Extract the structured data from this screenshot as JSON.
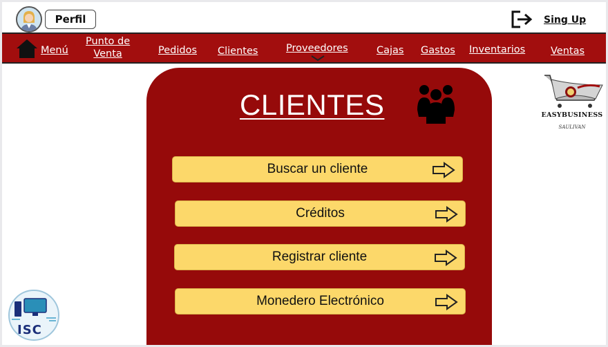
{
  "header": {
    "profile_label": "Perfil",
    "signup_label": "Sing Up"
  },
  "nav": {
    "items": [
      {
        "label": "Menú"
      },
      {
        "label": "Punto de Venta",
        "line1": "Punto de",
        "line2": "Venta"
      },
      {
        "label": "Pedidos"
      },
      {
        "label": "Clientes"
      },
      {
        "label": "Proveedores"
      },
      {
        "label": "Cajas"
      },
      {
        "label": "Gastos"
      },
      {
        "label": "Inventarios"
      },
      {
        "label": "Ventas"
      }
    ]
  },
  "panel": {
    "title": "CLIENTES",
    "options": [
      {
        "label": "Buscar un cliente"
      },
      {
        "label": "Créditos"
      },
      {
        "label": "Registrar cliente"
      },
      {
        "label": "Monedero Electrónico"
      }
    ]
  },
  "brand": {
    "name": "EASYBUSINESS",
    "tagline": "SAULIVAN"
  },
  "footer_logo": {
    "text": "ISC"
  },
  "colors": {
    "nav_bg": "#a20e0e",
    "panel_bg": "#960a0a",
    "button_bg": "#fcd86a",
    "text_on_red": "#ffffff"
  }
}
